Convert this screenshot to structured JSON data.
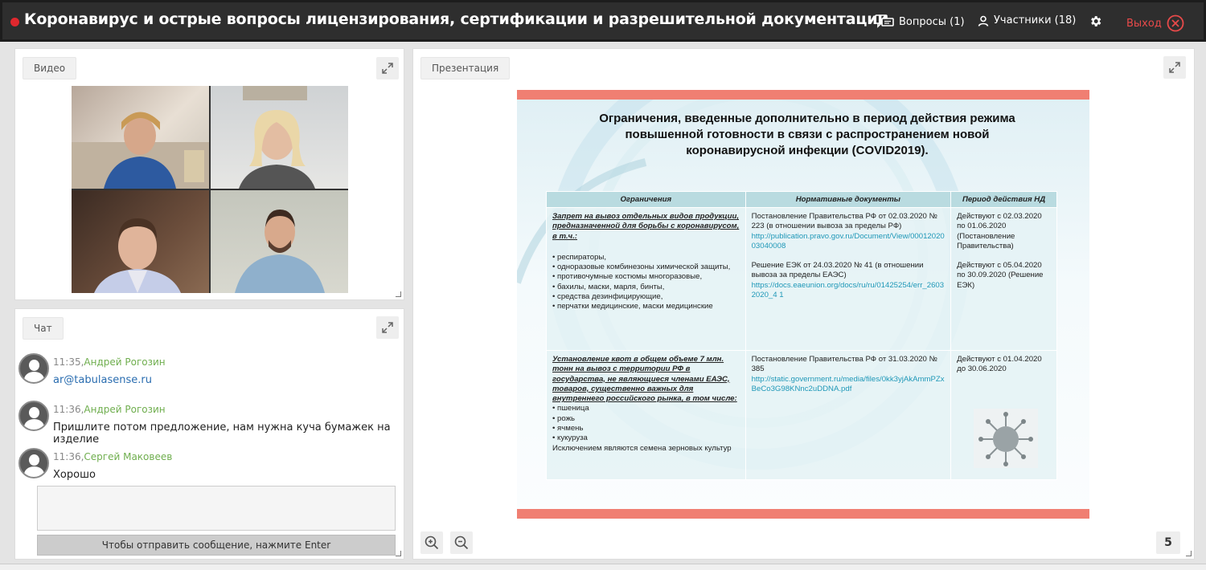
{
  "header": {
    "title": "Коронавирус и острые вопросы лицензирования, сертификации и разрешительной документации",
    "questions": "Вопросы (1)",
    "participants": "Участники (18)",
    "exit": "Выход"
  },
  "video": {
    "label": "Видео"
  },
  "chat": {
    "label": "Чат",
    "messages": [
      {
        "time": "11:35,",
        "author": "Андрей Рогозин",
        "text": "ar@tabulasense.ru"
      },
      {
        "time": "11:36,",
        "author": "Андрей Рогозин",
        "text": "Пришлите потом предложение, нам нужна куча бумажек на изделие"
      },
      {
        "time": "11:36,",
        "author": "Сергей Маковеев",
        "text": "Хорошо"
      }
    ],
    "send_hint": "Чтобы отправить сообщение, нажмите Enter"
  },
  "presentation": {
    "label": "Презентация",
    "page": "5",
    "slide": {
      "title_l1": "Ограничения, введенные дополнительно в период действия режима",
      "title_l2": "повышенной готовности в связи с распространением новой",
      "title_l3": "коронавирусной инфекции (COVID2019).",
      "col1": "Ограничения",
      "col2": "Нормативные документы",
      "col3": "Период действия НД",
      "r1c1_head": "Запрет на  вывоз отдельных видов продукции, предназначенной для борьбы с коронавирусом, в т.ч.:",
      "r1c1_l1": "• респираторы,",
      "r1c1_l2": "• одноразовые комбинезоны химической защиты,",
      "r1c1_l3": "• противочумные костюмы многоразовые,",
      "r1c1_l4": "• бахилы, маски, марля, бинты,",
      "r1c1_l5": "• средства дезинфицирующие,",
      "r1c1_l6": "• перчатки медицинские, маски медицинские",
      "r1c2_a": "Постановление Правительства РФ от 02.03.2020 № 223 (в отношении вывоза за пределы РФ)",
      "r1c2_a_link": "http://publication.pravo.gov.ru/Document/View/0001202003040008",
      "r1c2_b": "Решение ЕЭК от 24.03.2020 № 41 (в отношении вывоза за пределы ЕАЭС)",
      "r1c2_b_link": "https://docs.eaeunion.org/docs/ru/ru/01425254/err_26032020_4 1",
      "r1c3_a": "Действуют с 02.03.2020 по 01.06.2020 (Постановление Правительства)",
      "r1c3_b": "Действуют с 05.04.2020 по 30.09.2020 (Решение ЕЭК)",
      "r2c1_head": "Установление  квот в общем объеме 7 млн. тонн на вывоз с территории РФ в государства, не являющиеся членами ЕАЭС, товаров, существенно важных для внутреннего российского рынка, в том числе:",
      "r2c1_l1": "• пшеница",
      "r2c1_l2": "• рожь",
      "r2c1_l3": "• ячмень",
      "r2c1_l4": "• кукуруза",
      "r2c1_l5": "Исключением являются семена зерновых культур",
      "r2c2": "Постановление Правительства РФ от 31.03.2020 № 385",
      "r2c2_link": "http://static.government.ru/media/files/0kk3yjAkAmmPZxBeCo3G98KNnc2uDDNA.pdf",
      "r2c3": "Действуют с 01.04.2020 до 30.06.2020"
    }
  },
  "colors": {
    "topbar": "#2e2e2e",
    "accent_red": "#e0282e",
    "chat_author": "#6fae4e",
    "slide_bar": "#f07f72",
    "slide_link": "#1f98b8"
  }
}
